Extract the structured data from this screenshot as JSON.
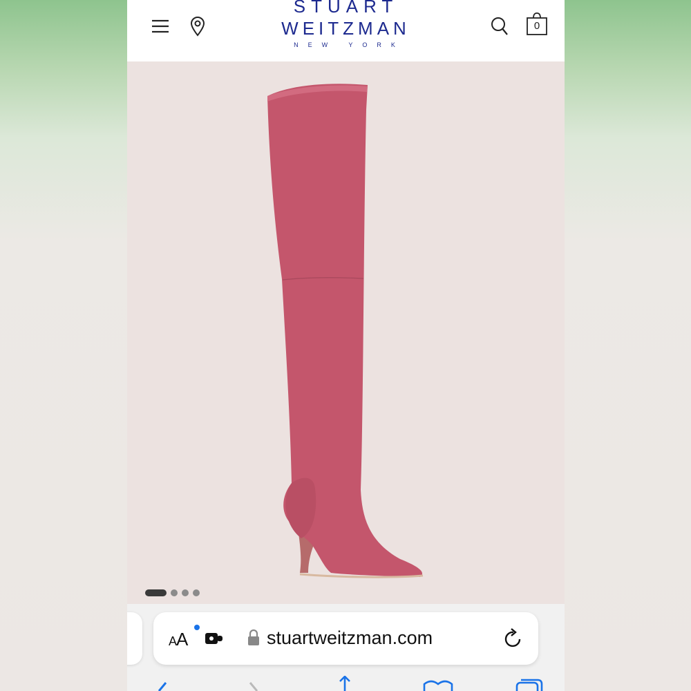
{
  "header": {
    "logo": {
      "line1": "STUART",
      "line2": "WEITZMAN",
      "line3": "NEW YORK"
    },
    "menu_icon": "hamburger-menu-icon",
    "location_icon": "map-pin-icon",
    "search_icon": "search-icon",
    "bag": {
      "icon": "shopping-bag-icon",
      "count": "0"
    }
  },
  "product": {
    "image": "thigh-high-boot-pink-suede",
    "boot_color": "#c4566c",
    "carousel": {
      "count": 4,
      "active": 1
    }
  },
  "browser": {
    "reader_label_small": "A",
    "reader_label_large": "A",
    "url": "stuartweitzman.com",
    "extension_icon": "puzzle-extension-icon",
    "lock_icon": "lock-icon",
    "reload_icon": "reload-icon",
    "toolbar": [
      "back-icon",
      "forward-icon",
      "share-icon",
      "bookmarks-icon",
      "tabs-icon"
    ]
  },
  "colors": {
    "accent": "#1d2a8f",
    "background": "#ece2e0",
    "link_blue": "#1a73e8"
  }
}
